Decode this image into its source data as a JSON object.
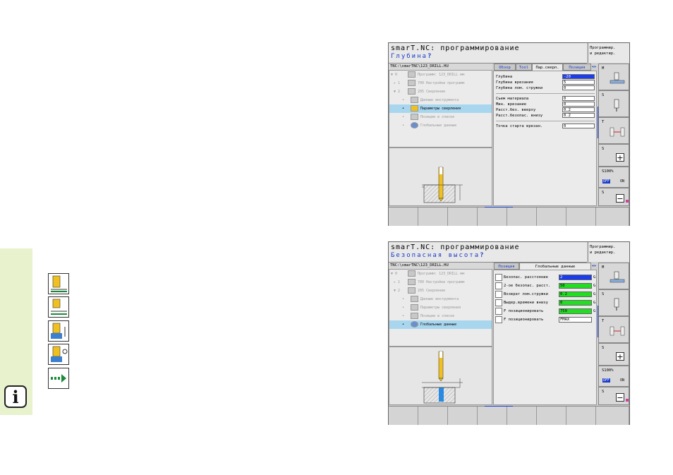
{
  "sidebar": {
    "info_icon": "info-icon",
    "icons": [
      "drill-depth-icon",
      "drill-plunge-icon",
      "drill-chipbreak-icon",
      "drill-dwell-icon",
      "next-arrow-icon"
    ]
  },
  "screens": [
    {
      "title": "smarT.NC: программирование",
      "subtitle": "Глубина",
      "subtitle_mark": "?",
      "mode": [
        "Программир.",
        "и редактир."
      ],
      "path": "TNC:\\smarTNC\\123_DRILL.HU",
      "tree": [
        {
          "marker": "▼ 0",
          "label": "Программ: 123_DRILL мм",
          "selected": false
        },
        {
          "marker": "▸ 1",
          "label": "700 Настройки программ",
          "selected": false
        },
        {
          "marker": "▼ 2",
          "label": "205 Сверление",
          "selected": false
        },
        {
          "marker": "•",
          "label": "Данные инструмента",
          "selected": false
        },
        {
          "marker": "•",
          "label": "Параметры сверления",
          "selected": true
        },
        {
          "marker": "•",
          "label": "Позиции в списке",
          "selected": false
        },
        {
          "marker": "•",
          "label": "Глобальные данные",
          "selected": false
        }
      ],
      "tabs": [
        {
          "label": "Обзор",
          "style": "blue"
        },
        {
          "label": "Tool",
          "style": "blue"
        },
        {
          "label": "Пар.сверл.",
          "style": "active"
        },
        {
          "label": "Позиция",
          "style": "blue"
        }
      ],
      "tab_arrow": "◂▸",
      "fields_a": [
        {
          "label": "Глубина",
          "value": "-20",
          "style": "blue"
        },
        {
          "label": "Глубина врезания",
          "value": "5",
          "style": ""
        },
        {
          "label": "Глубина лом. стружки",
          "value": "0",
          "style": ""
        }
      ],
      "fields_b": [
        {
          "label": "Съем материала",
          "value": "0",
          "style": ""
        },
        {
          "label": "Мин. врезание",
          "value": "0",
          "style": ""
        },
        {
          "label": "Расст.без. вверху",
          "value": "0.2",
          "style": ""
        },
        {
          "label": "Расст.безопас. внизу",
          "value": "0.2",
          "style": ""
        }
      ],
      "fields_c": [
        {
          "label": "Точка старта врезан.",
          "value": "0",
          "style": ""
        }
      ]
    },
    {
      "title": "smarT.NC: программирование",
      "subtitle": "Безопасная высота",
      "subtitle_mark": "?",
      "mode": [
        "Программир.",
        "и редактир."
      ],
      "path": "TNC:\\smarTNC\\123_DRILL.HU",
      "tree": [
        {
          "marker": "▼ 0",
          "label": "Программ: 123_DRILL мм",
          "selected": false
        },
        {
          "marker": "▸ 1",
          "label": "700 Настройки программ",
          "selected": false
        },
        {
          "marker": "▼ 2",
          "label": "205 Сверление",
          "selected": false
        },
        {
          "marker": "•",
          "label": "Данные инструмента",
          "selected": false
        },
        {
          "marker": "•",
          "label": "Параметры сверления",
          "selected": false
        },
        {
          "marker": "•",
          "label": "Позиции в списке",
          "selected": false
        },
        {
          "marker": "•",
          "label": "Глобальные данные",
          "selected": true
        }
      ],
      "tabs": [
        {
          "label": "Позиция",
          "style": "blue"
        },
        {
          "label": "Глобальные данные",
          "style": "active"
        }
      ],
      "tab_arrow": "◂▸",
      "globals": [
        {
          "label": "Безопас. расстояние",
          "value": "2",
          "style": "blue",
          "g": "G"
        },
        {
          "label": "2-ое безопас. расст.",
          "value": "50",
          "style": "green",
          "g": "G"
        },
        {
          "label": "Возврат лом.стружки",
          "value": "0.2",
          "style": "green",
          "g": "G"
        },
        {
          "label": "Выдер.времени внизу",
          "value": "0",
          "style": "green",
          "g": "G"
        },
        {
          "label": "F позиционировать",
          "value": "750",
          "style": "green",
          "g": "G"
        },
        {
          "label": "F позиционировать",
          "value": "FMAX",
          "style": "",
          "g": ""
        }
      ]
    }
  ],
  "vsoftkeys": [
    {
      "label": "M",
      "icon": "machine-function-icon"
    },
    {
      "label": "S",
      "icon": "spindle-icon"
    },
    {
      "label": "T",
      "icon": "tool-change-icon"
    },
    {
      "label": "S",
      "icon": "spindle-plus-icon"
    },
    {
      "label": "S100%",
      "icon": "override-icon",
      "off": "OFF",
      "on": "ON"
    },
    {
      "label": "S",
      "icon": "spindle-minus-icon"
    }
  ]
}
